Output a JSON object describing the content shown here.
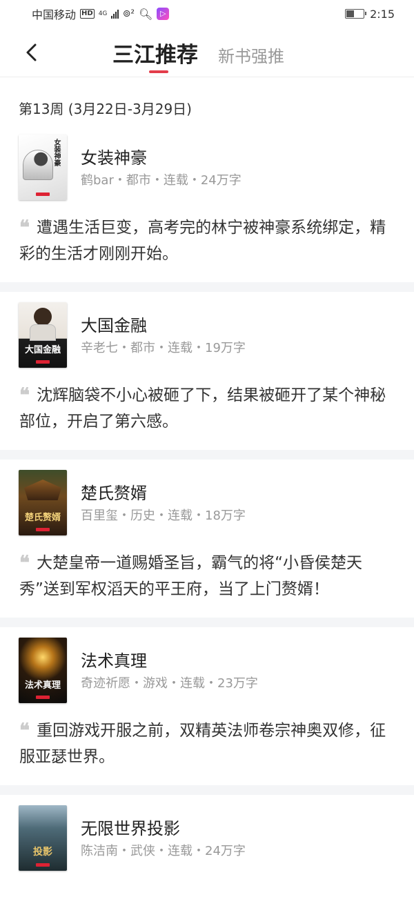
{
  "status_bar": {
    "carrier": "中国移动",
    "hd": "HD",
    "network": "4G",
    "time": "2:15",
    "battery_percent": 50
  },
  "nav": {
    "back_icon": "chevron-left-icon",
    "active_tab": "三江推荐",
    "inactive_tab": "新书强推",
    "accent_color": "#e33d4a"
  },
  "week_label": "第13周 (3月22日-3月29日)",
  "books": [
    {
      "title": "女装神豪",
      "meta": "鹤bar・都市・连载・24万字",
      "blurb": "遭遇生活巨变，高考完的林宁被神豪系统绑定，精彩的生活才刚刚开始。",
      "cover_text": "女装神豪"
    },
    {
      "title": "大国金融",
      "meta": "辛老七・都市・连载・19万字",
      "blurb": "沈辉脑袋不小心被砸了下，结果被砸开了某个神秘部位，开启了第六感。",
      "cover_text": "大国金融"
    },
    {
      "title": "楚氏赘婿",
      "meta": "百里玺・历史・连载・18万字",
      "blurb": "大楚皇帝一道赐婚圣旨，霸气的将“小昏侯楚天秀”送到军权滔天的平王府，当了上门赘婿！",
      "cover_text": "楚氏赘婿"
    },
    {
      "title": "法术真理",
      "meta": "奇迹祈愿・游戏・连载・23万字",
      "blurb": "重回游戏开服之前，双精英法师卷宗神奥双修，征服亚瑟世界。",
      "cover_text": "法术真理"
    },
    {
      "title": "无限世界投影",
      "meta": "陈洁南・武侠・连载・24万字",
      "blurb": "",
      "cover_text": "投影"
    }
  ],
  "quote_glyph": "❝"
}
